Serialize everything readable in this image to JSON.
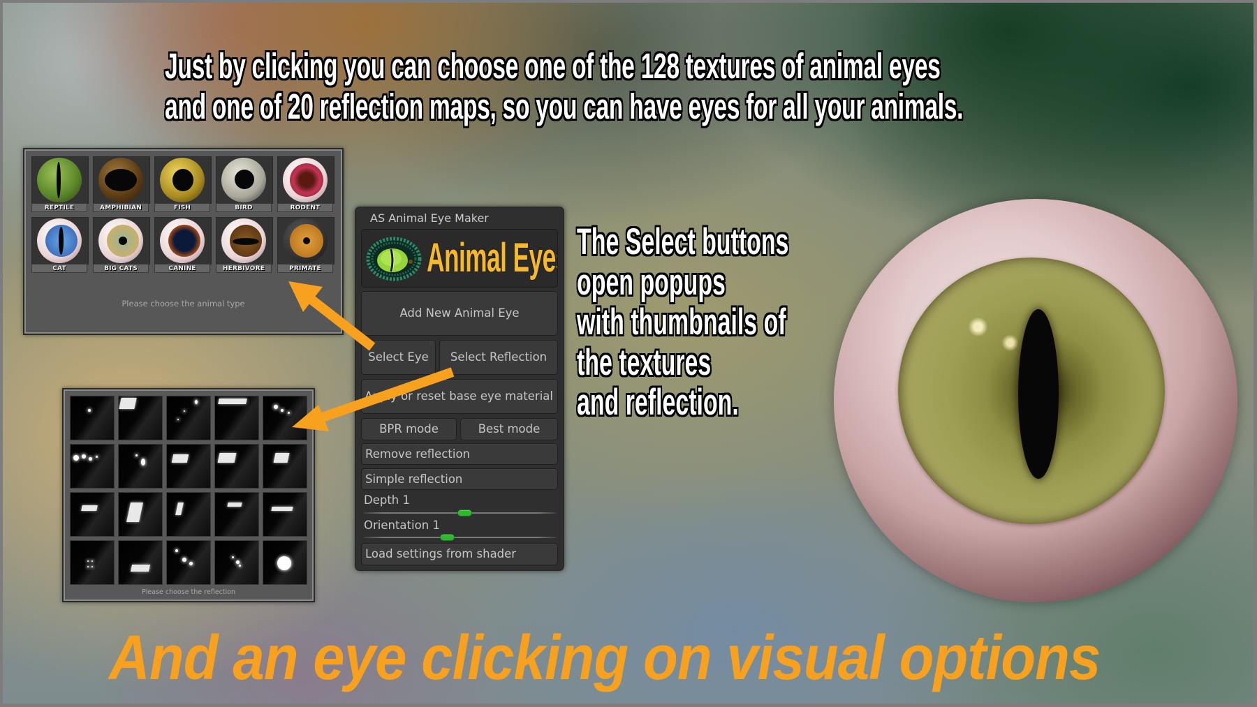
{
  "headline": {
    "lines": [
      "Just by clicking you can choose one of the 128 textures of animal eyes",
      "and one of 20 reflection maps, so you can have eyes for all your animals."
    ]
  },
  "description": {
    "lines": [
      "The Select buttons",
      "open popups",
      "with thumbnails of",
      "the textures",
      "and reflection."
    ]
  },
  "tagline": "And an eye clicking on visual options",
  "colors": {
    "tagline": "#f7a11f",
    "arrow": "#f7a11f",
    "logo_text": "#f6b92b",
    "slider_thumb": "#2eb82e"
  },
  "eye_popup": {
    "caption": "Please choose the animal type",
    "types": [
      {
        "label": "REPTILE",
        "icon": "reptile-eye-icon"
      },
      {
        "label": "AMPHIBIAN",
        "icon": "amphibian-eye-icon"
      },
      {
        "label": "FISH",
        "icon": "fish-eye-icon"
      },
      {
        "label": "BIRD",
        "icon": "bird-eye-icon"
      },
      {
        "label": "RODENT",
        "icon": "rodent-eye-icon"
      },
      {
        "label": "CAT",
        "icon": "cat-eye-icon"
      },
      {
        "label": "BIG CATS",
        "icon": "big-cats-eye-icon"
      },
      {
        "label": "CANINE",
        "icon": "canine-eye-icon"
      },
      {
        "label": "HERBIVORE",
        "icon": "herbivore-eye-icon"
      },
      {
        "label": "PRIMATE",
        "icon": "primate-eye-icon"
      }
    ]
  },
  "reflection_popup": {
    "caption": "Please choose the reflection",
    "thumbnail_count": 20
  },
  "panel": {
    "title": "AS Animal Eye Maker",
    "logo_text": "Animal Eyes",
    "buttons": {
      "add_new": "Add New Animal Eye",
      "select_eye": "Select Eye",
      "select_reflection": "Select Reflection",
      "apply_reset": "Apply or reset base eye material",
      "bpr_mode": "BPR mode",
      "best_mode": "Best mode",
      "remove_reflection": "Remove reflection",
      "simple_reflection": "Simple reflection",
      "load_settings": "Load settings from shader"
    },
    "sliders": [
      {
        "label": "Depth 1",
        "value": 1,
        "fraction": 0.52
      },
      {
        "label": "Orientation 1",
        "value": 1,
        "fraction": 0.43
      }
    ]
  }
}
